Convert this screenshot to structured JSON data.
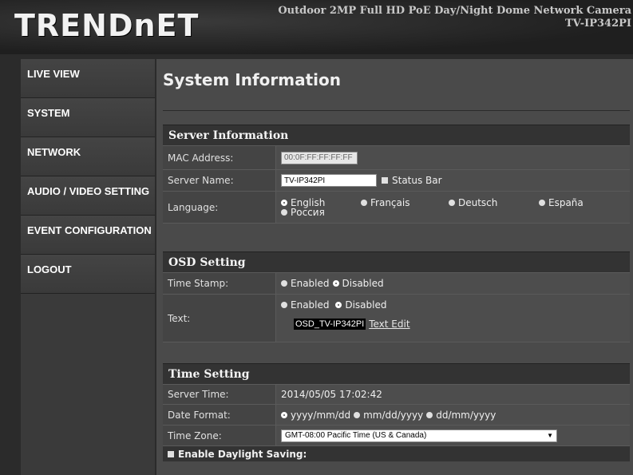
{
  "header": {
    "logo": "TRENDnET",
    "product_line1": "Outdoor 2MP Full HD PoE Day/Night Dome Network Camera",
    "product_line2": "TV-IP342PI"
  },
  "sidebar": {
    "items": [
      {
        "label": "LIVE VIEW"
      },
      {
        "label": "SYSTEM"
      },
      {
        "label": "NETWORK"
      },
      {
        "label": "AUDIO / VIDEO SETTING"
      },
      {
        "label": "EVENT CONFIGURATION"
      },
      {
        "label": "LOGOUT"
      }
    ]
  },
  "main": {
    "title": "System Information",
    "server_info": {
      "header": "Server Information",
      "mac_label": "MAC Address:",
      "mac_value": "00:0F:FF:FF:FF:FF",
      "name_label": "Server Name:",
      "name_value": "TV-IP342PI",
      "status_bar_label": "Status Bar",
      "language_label": "Language:",
      "languages": [
        "English",
        "Français",
        "Deutsch",
        "España",
        "Россия"
      ],
      "selected_language": "English"
    },
    "osd": {
      "header": "OSD Setting",
      "timestamp_label": "Time Stamp:",
      "timestamp_enabled": "Enabled",
      "timestamp_disabled": "Disabled",
      "text_label": "Text:",
      "text_enabled": "Enabled",
      "text_disabled": "Disabled",
      "osd_text_value": "OSD_TV-IP342PI",
      "text_edit_link": "Text Edit"
    },
    "time": {
      "header": "Time Setting",
      "server_time_label": "Server Time:",
      "server_time_value": "2014/05/05 17:02:42",
      "date_format_label": "Date Format:",
      "date_formats": [
        "yyyy/mm/dd",
        "mm/dd/yyyy",
        "dd/mm/yyyy"
      ],
      "selected_date_format": "yyyy/mm/dd",
      "timezone_label": "Time Zone:",
      "timezone_value": "GMT-08:00 Pacific Time (US & Canada)",
      "dst_label": "Enable Daylight Saving:"
    }
  }
}
